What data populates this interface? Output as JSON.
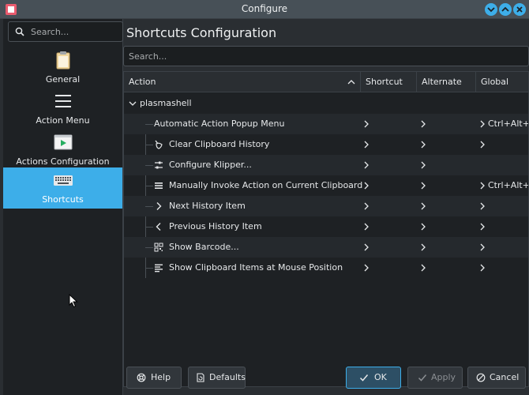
{
  "window": {
    "title": "Configure",
    "controls": [
      "minimize",
      "maximize",
      "close"
    ]
  },
  "sidebar": {
    "search_placeholder": "Search...",
    "categories": [
      {
        "label": "General",
        "icon": "clipboard-icon",
        "selected": false
      },
      {
        "label": "Action Menu",
        "icon": "menu-icon",
        "selected": false
      },
      {
        "label": "Actions Configuration",
        "icon": "play-icon",
        "selected": false
      },
      {
        "label": "Shortcuts",
        "icon": "keyboard-icon",
        "selected": true
      }
    ]
  },
  "main": {
    "title": "Shortcuts Configuration",
    "search_placeholder": "Search...",
    "columns": [
      "Action",
      "Shortcut",
      "Alternate",
      "Global"
    ],
    "group": "plasmashell",
    "rows": [
      {
        "label": "Automatic Action Popup Menu",
        "icon": "",
        "global": "Ctrl+Alt+"
      },
      {
        "label": "Clear Clipboard History",
        "icon": "broom-icon",
        "global": ""
      },
      {
        "label": "Configure Klipper...",
        "icon": "sliders-icon",
        "global": ""
      },
      {
        "label": "Manually Invoke Action on Current Clipboard",
        "icon": "menu-icon",
        "global": "Ctrl+Alt+"
      },
      {
        "label": "Next History Item",
        "icon": "chevron-right-icon",
        "global": ""
      },
      {
        "label": "Previous History Item",
        "icon": "chevron-left-icon",
        "global": ""
      },
      {
        "label": "Show Barcode...",
        "icon": "qrcode-icon",
        "global": ""
      },
      {
        "label": "Show Clipboard Items at Mouse Position",
        "icon": "list-icon",
        "global": ""
      }
    ]
  },
  "buttons": {
    "help": "Help",
    "defaults": "Defaults",
    "ok": "OK",
    "apply": "Apply",
    "cancel": "Cancel"
  },
  "colors": {
    "accent": "#3daee9",
    "background": "#2a2e32",
    "view_background": "#1e2124"
  }
}
